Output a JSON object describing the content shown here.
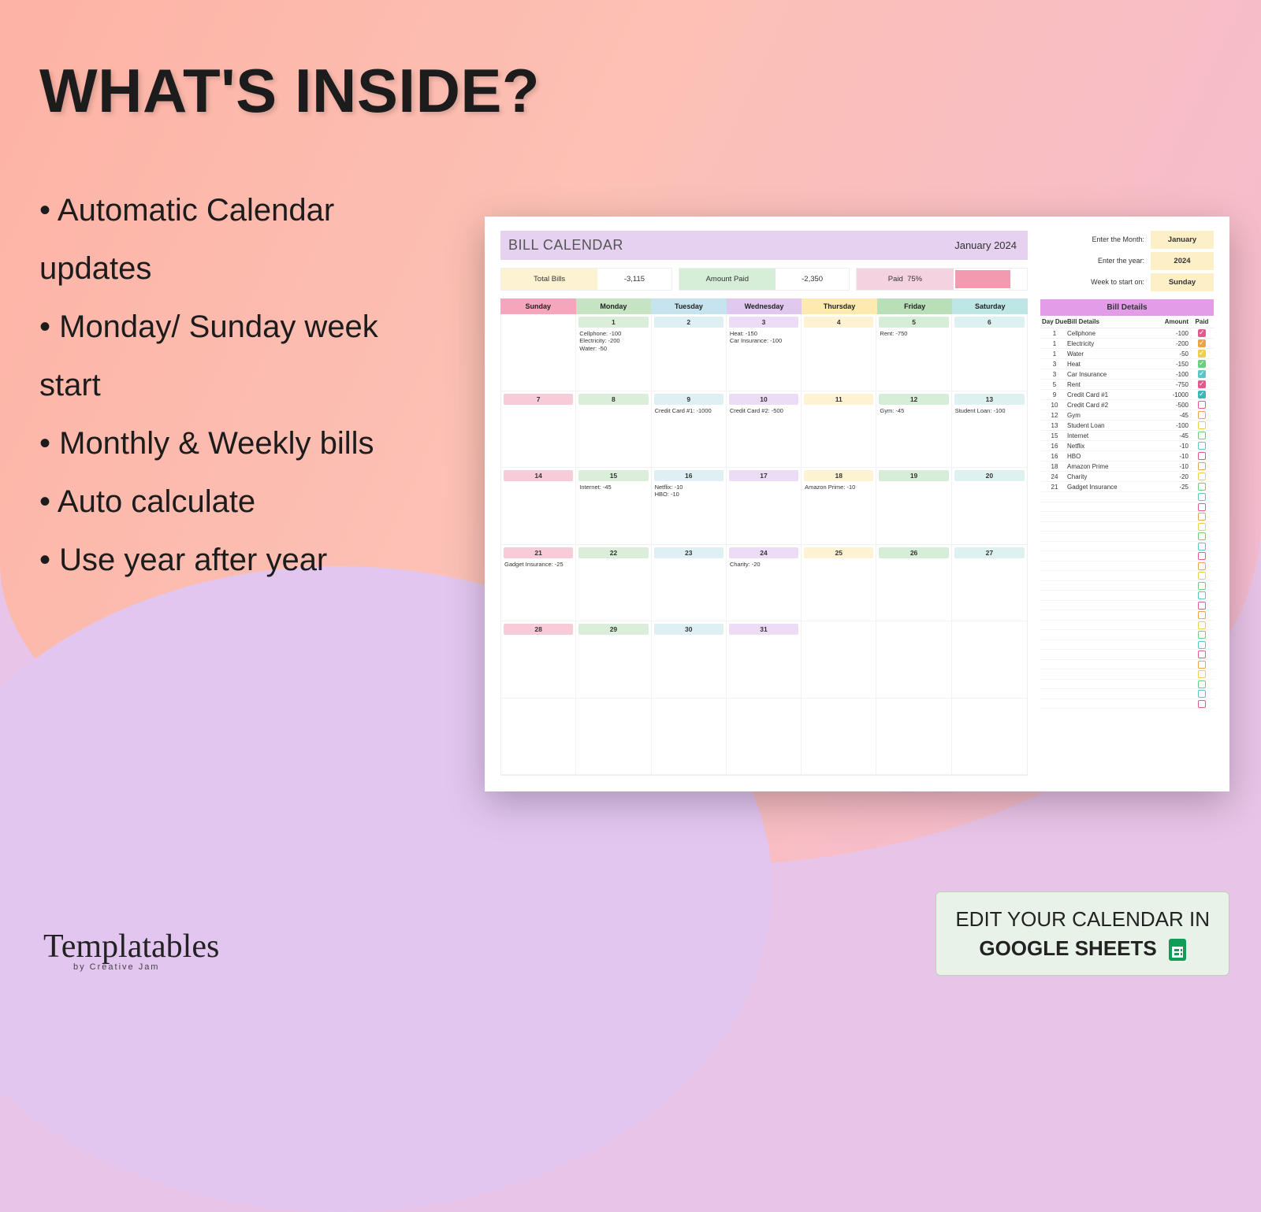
{
  "headline": "WHAT'S INSIDE?",
  "bullets": [
    "Automatic Calendar updates",
    "Monday/ Sunday week start",
    "Monthly & Weekly bills",
    "Auto calculate",
    "Use year after year"
  ],
  "logo": {
    "name": "Templatables",
    "by": "by Creative Jam"
  },
  "cta": {
    "line1": "EDIT YOUR CALENDAR IN",
    "line2": "GOOGLE SHEETS"
  },
  "sheet": {
    "title": "BILL CALENDAR",
    "month_label": "January 2024",
    "stats": {
      "total_bills": {
        "label": "Total Bills",
        "value": "-3,115"
      },
      "amount_paid": {
        "label": "Amount Paid",
        "value": "-2,350"
      },
      "paid": {
        "label": "Paid",
        "value": "75%"
      }
    },
    "days": [
      "Sunday",
      "Monday",
      "Tuesday",
      "Wednesday",
      "Thursday",
      "Friday",
      "Saturday"
    ],
    "grid": [
      [
        null,
        {
          "d": "1",
          "ev": [
            "Cellphone: -100",
            "Electricity: -200",
            "Water: -50"
          ]
        },
        {
          "d": "2"
        },
        {
          "d": "3",
          "ev": [
            "Heat: -150",
            "Car Insurance: -100"
          ]
        },
        {
          "d": "4"
        },
        {
          "d": "5",
          "ev": [
            "Rent: -750"
          ]
        },
        {
          "d": "6"
        }
      ],
      [
        {
          "d": "7"
        },
        {
          "d": "8"
        },
        {
          "d": "9",
          "ev": [
            "Credit Card #1: -1000"
          ]
        },
        {
          "d": "10",
          "ev": [
            "Credit Card #2: -500"
          ]
        },
        {
          "d": "11"
        },
        {
          "d": "12",
          "ev": [
            "Gym: -45"
          ]
        },
        {
          "d": "13",
          "ev": [
            "Student Loan: -100"
          ]
        }
      ],
      [
        {
          "d": "14"
        },
        {
          "d": "15",
          "ev": [
            "Internet: -45"
          ]
        },
        {
          "d": "16",
          "ev": [
            "Netflix: -10",
            "HBO: -10"
          ]
        },
        {
          "d": "17"
        },
        {
          "d": "18",
          "ev": [
            "Amazon Prime: -10"
          ]
        },
        {
          "d": "19"
        },
        {
          "d": "20"
        }
      ],
      [
        {
          "d": "21",
          "ev": [
            "Gadget Insurance: -25"
          ]
        },
        {
          "d": "22"
        },
        {
          "d": "23"
        },
        {
          "d": "24",
          "ev": [
            "Charity: -20"
          ]
        },
        {
          "d": "25"
        },
        {
          "d": "26"
        },
        {
          "d": "27"
        }
      ],
      [
        {
          "d": "28"
        },
        {
          "d": "29"
        },
        {
          "d": "30"
        },
        {
          "d": "31"
        },
        null,
        null,
        null
      ],
      [
        null,
        null,
        null,
        null,
        null,
        null,
        null
      ]
    ]
  },
  "side": {
    "inputs": [
      {
        "label": "Enter the Month:",
        "value": "January"
      },
      {
        "label": "Enter the year:",
        "value": "2024"
      },
      {
        "label": "Week to start on:",
        "value": "Sunday"
      }
    ],
    "bd_header": "Bill Details",
    "cols": {
      "c1": "Day Due",
      "c2": "Bill Details",
      "c3": "Amount",
      "c4": "Paid"
    },
    "rows": [
      {
        "d": "1",
        "n": "Cellphone",
        "a": "-100",
        "p": true,
        "c": "#e45a8f"
      },
      {
        "d": "1",
        "n": "Electricity",
        "a": "-200",
        "p": true,
        "c": "#f0a247"
      },
      {
        "d": "1",
        "n": "Water",
        "a": "-50",
        "p": true,
        "c": "#e9d24a"
      },
      {
        "d": "3",
        "n": "Heat",
        "a": "-150",
        "p": true,
        "c": "#6bcf7f"
      },
      {
        "d": "3",
        "n": "Car Insurance",
        "a": "-100",
        "p": true,
        "c": "#5ac7c4"
      },
      {
        "d": "5",
        "n": "Rent",
        "a": "-750",
        "p": true,
        "c": "#e45a8f"
      },
      {
        "d": "9",
        "n": "Credit Card #1",
        "a": "-1000",
        "p": true,
        "c": "#3ab9b5"
      },
      {
        "d": "10",
        "n": "Credit Card #2",
        "a": "-500",
        "p": false,
        "c": "#e45a8f"
      },
      {
        "d": "12",
        "n": "Gym",
        "a": "-45",
        "p": false,
        "c": "#f0a247"
      },
      {
        "d": "13",
        "n": "Student Loan",
        "a": "-100",
        "p": false,
        "c": "#e9d24a"
      },
      {
        "d": "15",
        "n": "Internet",
        "a": "-45",
        "p": false,
        "c": "#6bcf7f"
      },
      {
        "d": "16",
        "n": "Netflix",
        "a": "-10",
        "p": false,
        "c": "#5ac7c4"
      },
      {
        "d": "16",
        "n": "HBO",
        "a": "-10",
        "p": false,
        "c": "#e45a8f"
      },
      {
        "d": "18",
        "n": "Amazon Prime",
        "a": "-10",
        "p": false,
        "c": "#f0a247"
      },
      {
        "d": "24",
        "n": "Charity",
        "a": "-20",
        "p": false,
        "c": "#e9d24a"
      },
      {
        "d": "21",
        "n": "Gadget Insurance",
        "a": "-25",
        "p": false,
        "c": "#6bcf7f"
      }
    ],
    "extra_colors": [
      "#5ac7c4",
      "#e45a8f",
      "#f0a247",
      "#e9d24a",
      "#6bcf7f",
      "#5ac7c4",
      "#e45a8f",
      "#f0a247",
      "#e9d24a",
      "#6bcf7f",
      "#5ac7c4",
      "#e45a8f",
      "#f0a247",
      "#e9d24a",
      "#6bcf7f",
      "#5ac7c4",
      "#e45a8f",
      "#f0a247",
      "#e9d24a",
      "#6bcf7f",
      "#5ac7c4",
      "#e45a8f"
    ]
  }
}
